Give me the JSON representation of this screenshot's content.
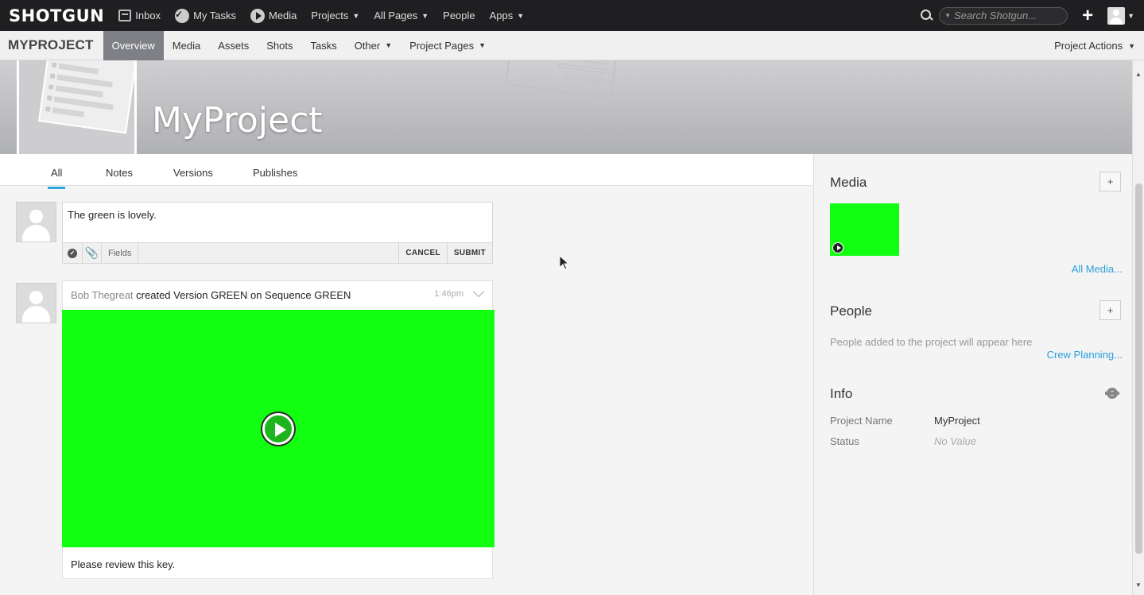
{
  "topnav": {
    "logo": "SHOTGUN",
    "items": [
      {
        "label": "Inbox"
      },
      {
        "label": "My Tasks"
      },
      {
        "label": "Media"
      },
      {
        "label": "Projects"
      },
      {
        "label": "All Pages"
      },
      {
        "label": "People"
      },
      {
        "label": "Apps"
      }
    ],
    "search_placeholder": "Search Shotgun...",
    "plus": "+"
  },
  "projnav": {
    "title": "MYPROJECT",
    "tabs": [
      {
        "label": "Overview"
      },
      {
        "label": "Media"
      },
      {
        "label": "Assets"
      },
      {
        "label": "Shots"
      },
      {
        "label": "Tasks"
      },
      {
        "label": "Other"
      },
      {
        "label": "Project Pages"
      }
    ],
    "actions": "Project Actions"
  },
  "banner": {
    "project_name": "MyProject"
  },
  "activity": {
    "tabs": [
      {
        "label": "All"
      },
      {
        "label": "Notes"
      },
      {
        "label": "Versions"
      },
      {
        "label": "Publishes"
      }
    ],
    "note": {
      "text": "The green is lovely.",
      "fields_label": "Fields",
      "cancel_label": "CANCEL",
      "submit_label": "SUBMIT"
    },
    "post": {
      "author": "Bob Thegreat",
      "action": "created Version GREEN on Sequence GREEN",
      "time": "1:46pm",
      "caption": "Please review this key."
    }
  },
  "sidebar": {
    "media": {
      "title": "Media",
      "link": "All Media..."
    },
    "people": {
      "title": "People",
      "hint": "People added to the project will appear here",
      "link": "Crew Planning..."
    },
    "info": {
      "title": "Info",
      "rows": [
        {
          "label": "Project Name",
          "value": "MyProject"
        },
        {
          "label": "Status",
          "value": "No Value"
        }
      ]
    },
    "plus": "+"
  },
  "colors": {
    "accent": "#2aa7e0",
    "link": "#2a9fd8",
    "green_media": "#12ff12",
    "topbar": "#1f1f21"
  }
}
